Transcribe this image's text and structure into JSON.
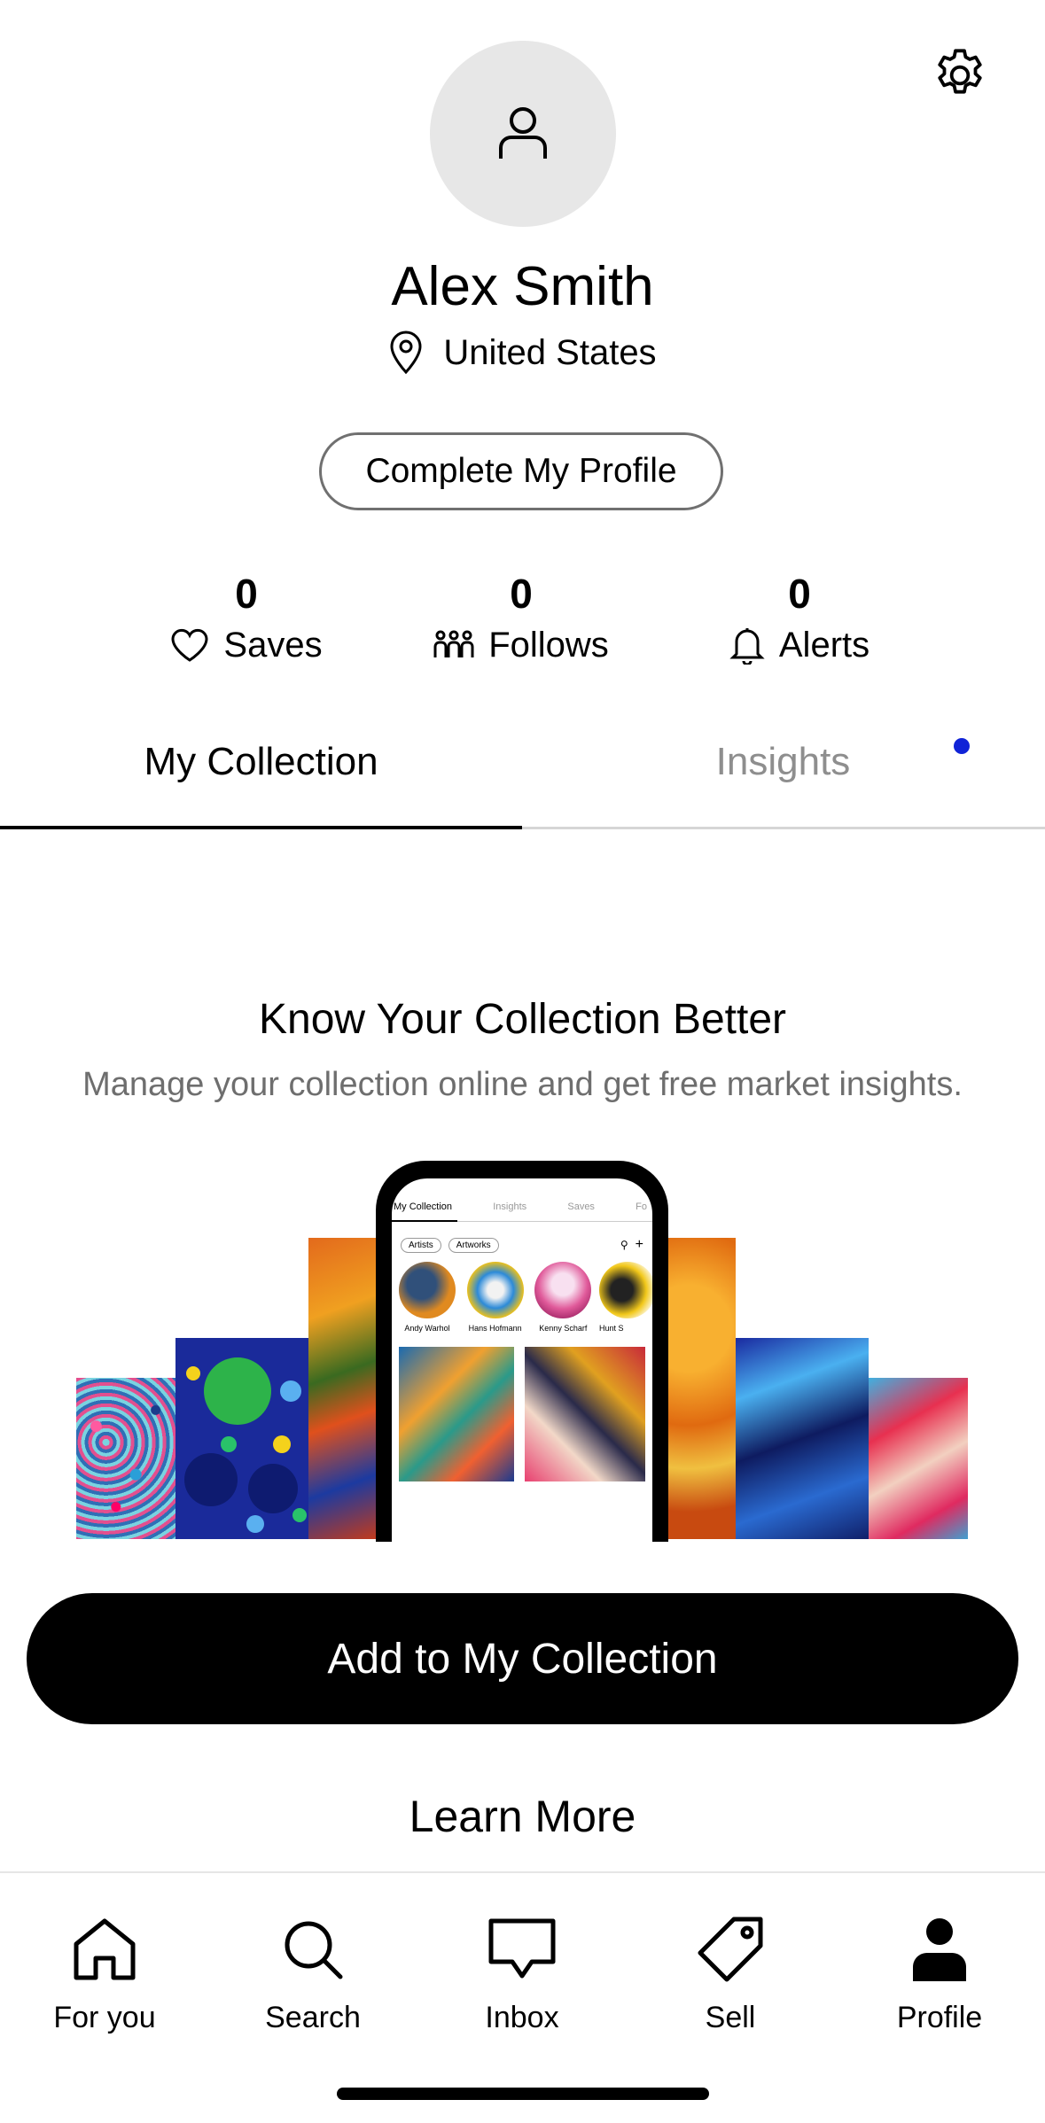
{
  "profile": {
    "name": "Alex Smith",
    "location": "United States",
    "complete_label": "Complete My Profile"
  },
  "stats": [
    {
      "count": "0",
      "label": "Saves",
      "icon": "heart-icon"
    },
    {
      "count": "0",
      "label": "Follows",
      "icon": "people-icon"
    },
    {
      "count": "0",
      "label": "Alerts",
      "icon": "bell-icon"
    }
  ],
  "tabs": {
    "active": "My Collection",
    "inactive": "Insights",
    "dot_color": "#1023d7"
  },
  "hero": {
    "title": "Know Your Collection Better",
    "subtitle": "Manage your collection online and get free market insights."
  },
  "phone_preview": {
    "tabs": [
      "My Collection",
      "Insights",
      "Saves",
      "Fo"
    ],
    "chips": [
      "Artists",
      "Artworks"
    ],
    "artists": [
      "Andy Warhol",
      "Hans Hofmann",
      "Kenny Scharf",
      "Hunt S"
    ]
  },
  "actions": {
    "add_label": "Add to My Collection",
    "learn_more_label": "Learn More"
  },
  "nav": [
    {
      "label": "For you",
      "icon": "home-icon"
    },
    {
      "label": "Search",
      "icon": "search-icon"
    },
    {
      "label": "Inbox",
      "icon": "inbox-icon"
    },
    {
      "label": "Sell",
      "icon": "tag-icon"
    },
    {
      "label": "Profile",
      "icon": "person-icon",
      "active": true
    }
  ]
}
